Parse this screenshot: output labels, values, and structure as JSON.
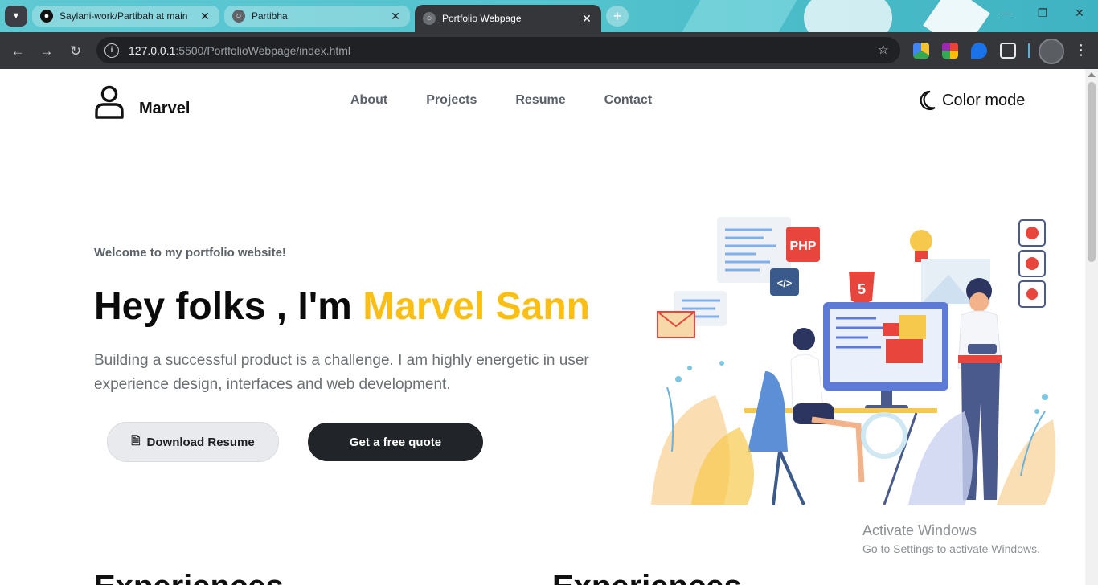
{
  "browser": {
    "tabs": [
      {
        "title": "Saylani-work/Partibah at main",
        "icon": "github-icon",
        "active": false
      },
      {
        "title": "Partibha",
        "icon": "globe-icon",
        "active": false
      },
      {
        "title": "Portfolio Webpage",
        "icon": "globe-icon",
        "active": true
      }
    ],
    "url_host": "127.0.0.1",
    "url_rest": ":5500/PortfolioWebpage/index.html"
  },
  "nav": {
    "brand": "Marvel",
    "links": [
      "About",
      "Projects",
      "Resume",
      "Contact"
    ],
    "color_mode": "Color mode"
  },
  "hero": {
    "welcome": "Welcome to my portfolio website!",
    "headline_prefix": "Hey folks , I'm ",
    "headline_name": "Marvel Sann",
    "description": "Building a successful product is a challenge. I am highly energetic in user experience design, interfaces and web development.",
    "download_label": "Download Resume",
    "quote_label": "Get a free quote",
    "php_label": "PHP",
    "html_label": "5",
    "code_label": "</>"
  },
  "sections": {
    "left_heading": "Experiences",
    "right_heading": "Experiences"
  },
  "watermark": {
    "title": "Activate Windows",
    "subtitle": "Go to Settings to activate Windows."
  },
  "colors": {
    "accent": "#fbbf14",
    "dark": "#212529"
  }
}
